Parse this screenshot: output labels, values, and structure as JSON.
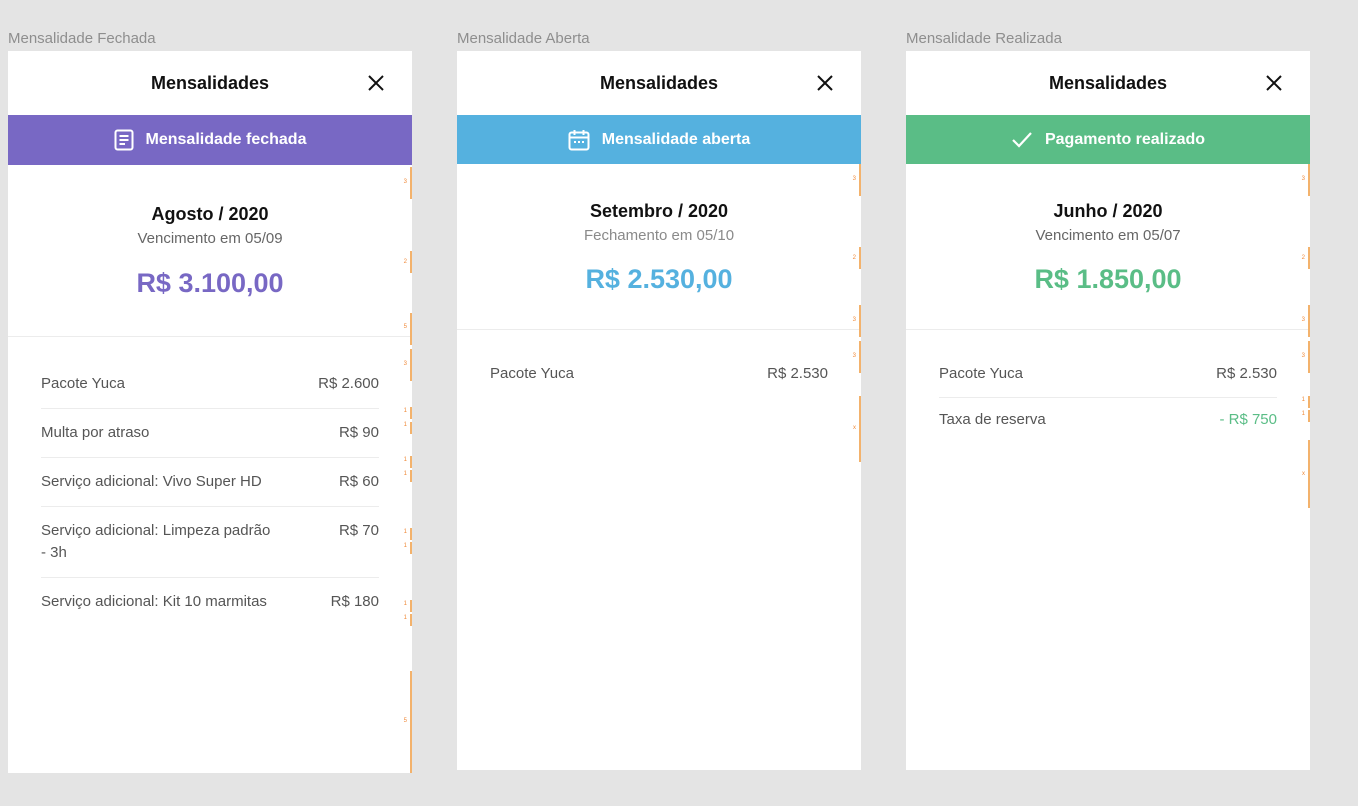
{
  "frames": [
    {
      "label": "Mensalidade Fechada",
      "title": "Mensalidades",
      "banner": {
        "text": "Mensalidade fechada",
        "icon": "document-icon",
        "color": "#7868c4"
      },
      "month": "Agosto / 2020",
      "due": "Vencimento em 05/09",
      "amount": "R$ 3.100,00",
      "amount_color": "#7868c4",
      "items": [
        {
          "label": "Pacote Yuca",
          "value": "R$ 2.600"
        },
        {
          "label": "Multa por atraso",
          "value": "R$ 90"
        },
        {
          "label": "Serviço adicional: Vivo Super HD",
          "value": "R$ 60"
        },
        {
          "label": "Serviço adicional: Limpeza padrão - 3h",
          "value": "R$ 70"
        },
        {
          "label": "Serviço adicional: Kit 10 marmitas",
          "value": "R$ 180"
        }
      ],
      "gutter_marks": [
        "3",
        "2",
        "5",
        "3",
        "1",
        "1",
        "1",
        "1",
        "1",
        "1",
        "1",
        "1",
        "5"
      ]
    },
    {
      "label": "Mensalidade Aberta",
      "title": "Mensalidades",
      "banner": {
        "text": "Mensalidade aberta",
        "icon": "calendar-icon",
        "color": "#55b1df"
      },
      "month": "Setembro / 2020",
      "due": "Fechamento em 05/10",
      "amount": "R$ 2.530,00",
      "amount_color": "#55b1df",
      "items": [
        {
          "label": "Pacote Yuca",
          "value": "R$ 2.530"
        }
      ],
      "gutter_marks": [
        "3",
        "2",
        "3",
        "3",
        "x"
      ]
    },
    {
      "label": "Mensalidade Realizada",
      "title": "Mensalidades",
      "banner": {
        "text": "Pagamento realizado",
        "icon": "check-icon",
        "color": "#5abd86"
      },
      "month": "Junho / 2020",
      "due": "Vencimento em 05/07",
      "amount": "R$ 1.850,00",
      "amount_color": "#5abd86",
      "items": [
        {
          "label": "Pacote Yuca",
          "value": "R$ 2.530"
        },
        {
          "label": "Taxa de reserva",
          "value": "- R$ 750",
          "value_color": "#5abd86"
        }
      ],
      "gutter_marks": [
        "3",
        "2",
        "3",
        "3",
        "1",
        "1",
        "x"
      ]
    }
  ]
}
